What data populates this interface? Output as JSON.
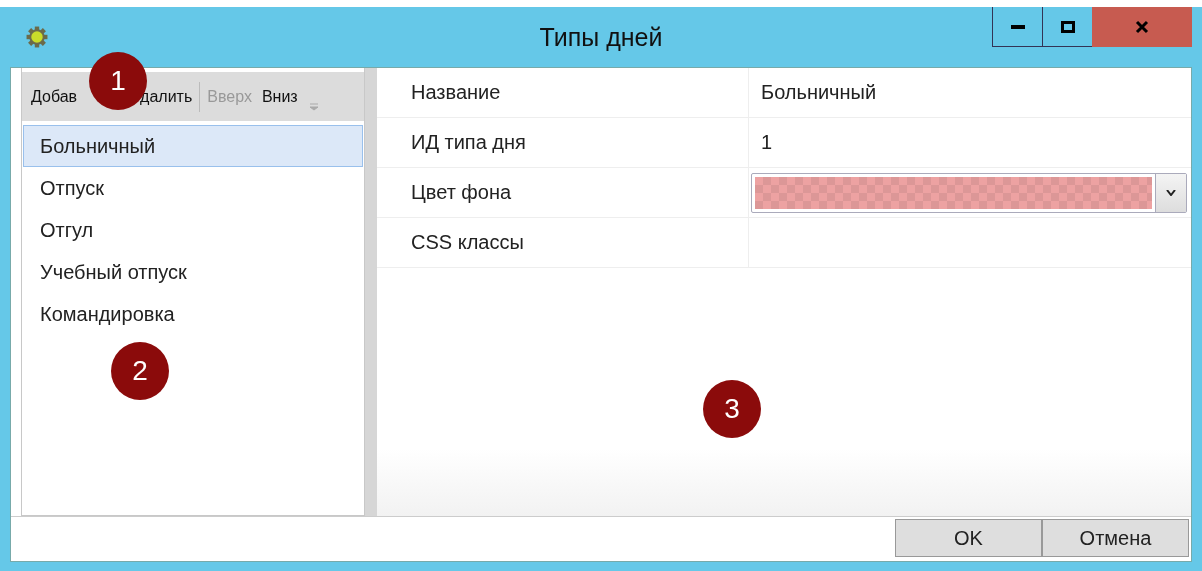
{
  "window": {
    "title": "Типы дней"
  },
  "toolbar": [
    {
      "label": "Добав",
      "disabled": false
    },
    {
      "label": "далить",
      "disabled": false
    },
    {
      "label": "Вверх",
      "disabled": true
    },
    {
      "label": "Вниз",
      "disabled": false
    }
  ],
  "list": [
    {
      "label": "Больничный",
      "selected": true
    },
    {
      "label": "Отпуск",
      "selected": false
    },
    {
      "label": "Отгул",
      "selected": false
    },
    {
      "label": "Учебный отпуск",
      "selected": false
    },
    {
      "label": "Командировка",
      "selected": false
    }
  ],
  "properties": [
    {
      "name": "Название",
      "kind": "text",
      "value": "Больничный"
    },
    {
      "name": "ИД типа дня",
      "kind": "text",
      "value": "1"
    },
    {
      "name": "Цвет фона",
      "kind": "color",
      "color": "#eda2a2"
    },
    {
      "name": "CSS классы",
      "kind": "text"
    }
  ],
  "buttons": [
    "OK",
    "Отмена"
  ],
  "callouts": [
    "1",
    "2",
    "3"
  ]
}
